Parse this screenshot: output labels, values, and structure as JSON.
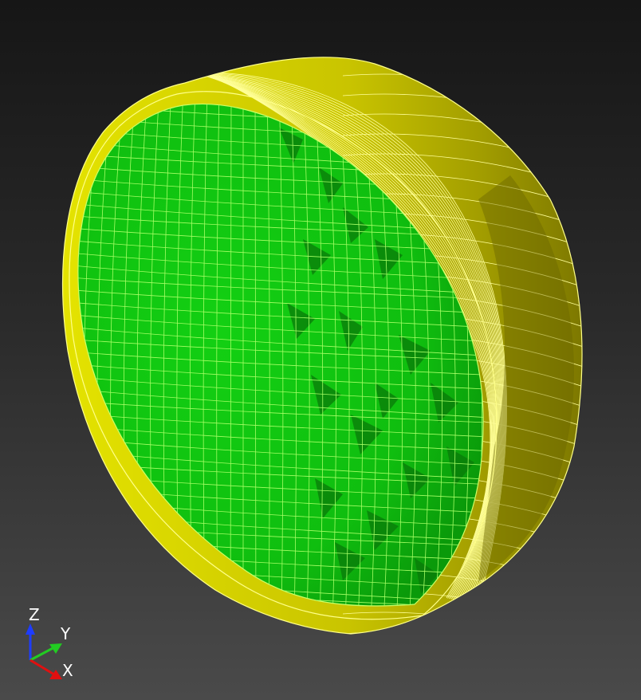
{
  "viewport": {
    "background_top": "#161616",
    "background_bottom": "#4a4a4a"
  },
  "model": {
    "shell_color": "#d8d800",
    "shell_dark_color": "#8f8a00",
    "core_color": "#0fc40f",
    "core_dark_color": "#0a7d0a",
    "mesh_line_color_shell": "#ffff99",
    "mesh_line_color_core": "#a6ff66"
  },
  "triad": {
    "z_label": "Z",
    "y_label": "Y",
    "x_label": "X",
    "z_color": "#1e3cff",
    "y_color": "#22cc22",
    "x_color": "#e01010"
  }
}
